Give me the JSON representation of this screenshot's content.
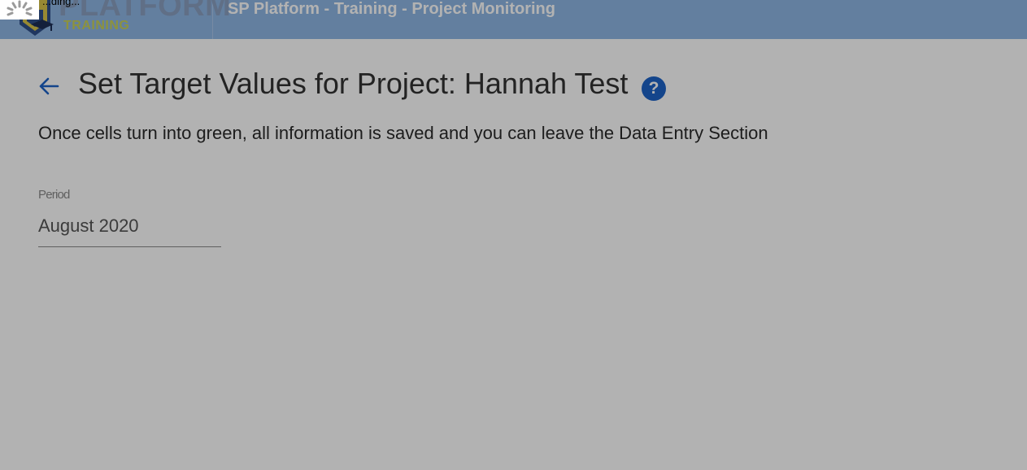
{
  "header": {
    "brand_name": "PLATFORM",
    "brand_sub": "TRAINING",
    "app_title": "SP Platform - Training - Project Monitoring"
  },
  "page": {
    "title": "Set Target Values for Project: Hannah Test",
    "info_text": "Once cells turn into green, all information is saved and you can leave the Data Entry Section",
    "help_icon": "?"
  },
  "period": {
    "label": "Period",
    "value": "August 2020"
  },
  "loading": {
    "label": "...ding..."
  },
  "icons": {
    "back": "arrow-left-icon",
    "help": "question-circle-icon",
    "logo": "platform-logo-icon",
    "spinner": "loading-spinner-icon"
  },
  "colors": {
    "header_bg": "#8fb6e4",
    "accent": "#1e63c8",
    "brand_training": "#c9d25a"
  }
}
